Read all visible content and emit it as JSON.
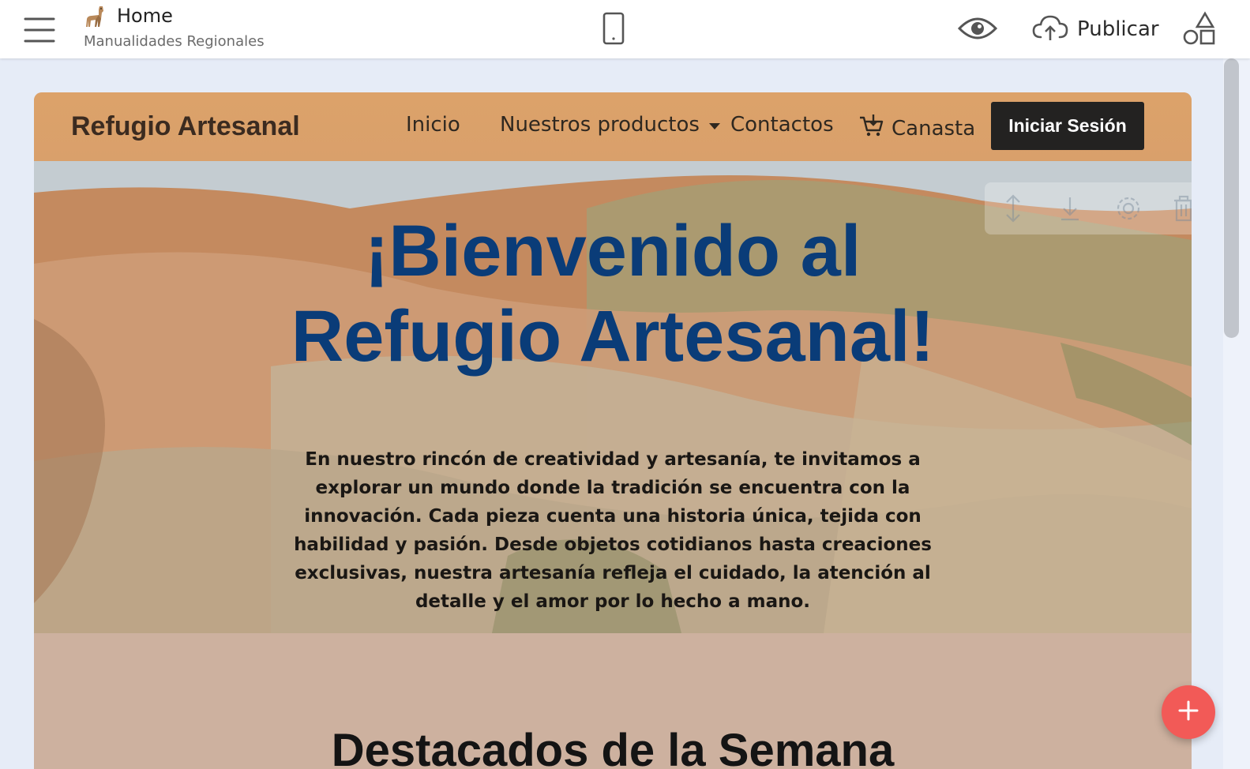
{
  "editor": {
    "page_title": "Home",
    "project_name": "Manualidades Regionales",
    "publish_label": "Publicar",
    "icons": {
      "menu": "hamburger-menu-icon",
      "logo": "llama-icon",
      "device": "mobile-phone-icon",
      "preview": "eye-icon",
      "publish": "cloud-upload-icon",
      "blocks": "shapes-icon",
      "add": "plus-icon"
    }
  },
  "site": {
    "brand": "Refugio Artesanal",
    "nav": {
      "home": "Inicio",
      "products": "Nuestros productos",
      "contacts": "Contactos",
      "cart": "Canasta",
      "login": "Iniciar Sesión"
    },
    "hero": {
      "title_line1": "¡Bienvenido al",
      "title_line2": "Refugio Artesanal!",
      "text": "En nuestro rincón de creatividad y artesanía, te invitamos a explorar un mundo donde la tradición se encuentra con la innovación. Cada pieza cuenta una historia única, tejida con habilidad y pasión. Desde objetos cotidianos hasta creaciones exclusivas, nuestra artesanía refleja el cuidado, la atención al detalle y el amor por lo hecho a mano."
    },
    "featured_title": "Destacados de la Semana"
  },
  "colors": {
    "nav_bg": "#dca26a",
    "hero_title": "#0a3c78",
    "login_bg": "#232221",
    "section_bg": "#cdb19f",
    "fab": "#f25a57"
  }
}
